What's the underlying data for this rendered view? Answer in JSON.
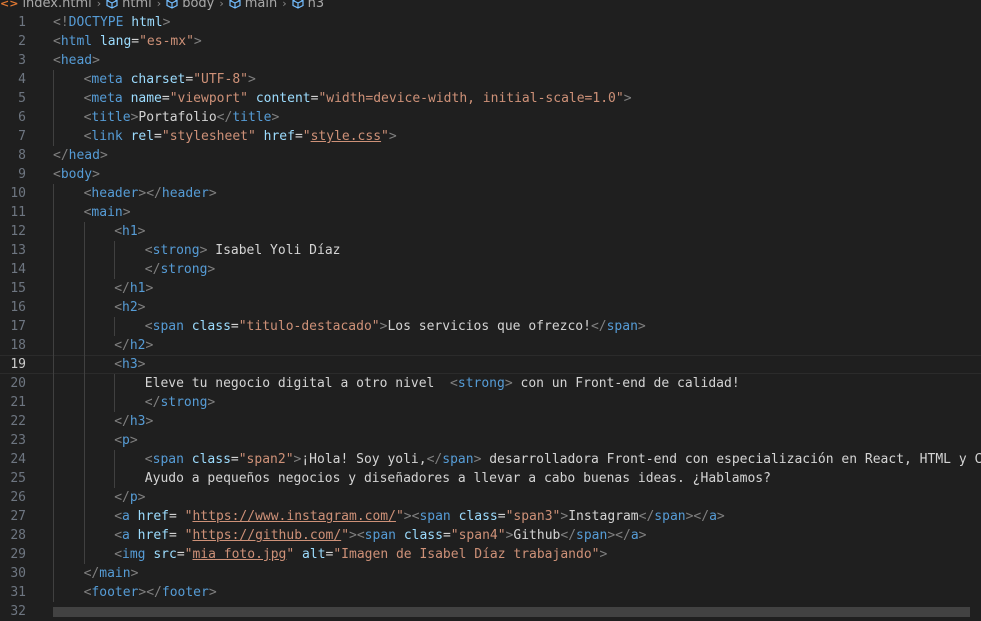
{
  "breadcrumb": {
    "file": "index.html",
    "items": [
      "html",
      "body",
      "main",
      "h3"
    ]
  },
  "active_line": 19,
  "colors": {
    "background": "#1f1f1f",
    "punctuation": "#808080",
    "tag": "#569cd6",
    "attribute": "#9cdcfe",
    "string": "#ce9178",
    "text": "#d4d4d4",
    "line_number": "#6e7681"
  },
  "lines": [
    {
      "n": "1",
      "indent": 0,
      "tokens": [
        [
          "t",
          "<!"
        ],
        [
          "tn",
          "DOCTYPE"
        ],
        [
          "tx",
          " "
        ],
        [
          "an",
          "html"
        ],
        [
          "t",
          ">"
        ]
      ]
    },
    {
      "n": "2",
      "indent": 0,
      "tokens": [
        [
          "t",
          "<"
        ],
        [
          "tn",
          "html"
        ],
        [
          "tx",
          " "
        ],
        [
          "an",
          "lang"
        ],
        [
          "tx",
          "="
        ],
        [
          "av",
          "\"es-mx\""
        ],
        [
          "t",
          ">"
        ]
      ]
    },
    {
      "n": "3",
      "indent": 0,
      "tokens": [
        [
          "t",
          "<"
        ],
        [
          "tn",
          "head"
        ],
        [
          "t",
          ">"
        ]
      ]
    },
    {
      "n": "4",
      "indent": 1,
      "tokens": [
        [
          "t",
          "<"
        ],
        [
          "tn",
          "meta"
        ],
        [
          "tx",
          " "
        ],
        [
          "an",
          "charset"
        ],
        [
          "tx",
          "="
        ],
        [
          "av",
          "\"UTF-8\""
        ],
        [
          "t",
          ">"
        ]
      ]
    },
    {
      "n": "5",
      "indent": 1,
      "tokens": [
        [
          "t",
          "<"
        ],
        [
          "tn",
          "meta"
        ],
        [
          "tx",
          " "
        ],
        [
          "an",
          "name"
        ],
        [
          "tx",
          "="
        ],
        [
          "av",
          "\"viewport\""
        ],
        [
          "tx",
          " "
        ],
        [
          "an",
          "content"
        ],
        [
          "tx",
          "="
        ],
        [
          "av",
          "\"width=device-width, initial-scale=1.0\""
        ],
        [
          "t",
          ">"
        ]
      ]
    },
    {
      "n": "6",
      "indent": 1,
      "tokens": [
        [
          "t",
          "<"
        ],
        [
          "tn",
          "title"
        ],
        [
          "t",
          ">"
        ],
        [
          "tx",
          "Portafolio"
        ],
        [
          "t",
          "</"
        ],
        [
          "tn",
          "title"
        ],
        [
          "t",
          ">"
        ]
      ]
    },
    {
      "n": "7",
      "indent": 1,
      "tokens": [
        [
          "t",
          "<"
        ],
        [
          "tn",
          "link"
        ],
        [
          "tx",
          " "
        ],
        [
          "an",
          "rel"
        ],
        [
          "tx",
          "="
        ],
        [
          "av",
          "\"stylesheet\""
        ],
        [
          "tx",
          " "
        ],
        [
          "an",
          "href"
        ],
        [
          "tx",
          "="
        ],
        [
          "av",
          "\""
        ],
        [
          "avu",
          "style.css"
        ],
        [
          "av",
          "\""
        ],
        [
          "t",
          ">"
        ]
      ]
    },
    {
      "n": "8",
      "indent": 0,
      "tokens": [
        [
          "t",
          "</"
        ],
        [
          "tn",
          "head"
        ],
        [
          "t",
          ">"
        ]
      ]
    },
    {
      "n": "9",
      "indent": 0,
      "tokens": [
        [
          "t",
          "<"
        ],
        [
          "tn",
          "body"
        ],
        [
          "t",
          ">"
        ]
      ]
    },
    {
      "n": "10",
      "indent": 1,
      "tokens": [
        [
          "t",
          "<"
        ],
        [
          "tn",
          "header"
        ],
        [
          "t",
          "></"
        ],
        [
          "tn",
          "header"
        ],
        [
          "t",
          ">"
        ]
      ]
    },
    {
      "n": "11",
      "indent": 1,
      "tokens": [
        [
          "t",
          "<"
        ],
        [
          "tn",
          "main"
        ],
        [
          "t",
          ">"
        ]
      ]
    },
    {
      "n": "12",
      "indent": 2,
      "tokens": [
        [
          "t",
          "<"
        ],
        [
          "tn",
          "h1"
        ],
        [
          "t",
          ">"
        ]
      ]
    },
    {
      "n": "13",
      "indent": 3,
      "tokens": [
        [
          "t",
          "<"
        ],
        [
          "tn",
          "strong"
        ],
        [
          "t",
          ">"
        ],
        [
          "tx",
          " Isabel Yoli Díaz"
        ]
      ]
    },
    {
      "n": "14",
      "indent": 3,
      "tokens": [
        [
          "t",
          "</"
        ],
        [
          "tn",
          "strong"
        ],
        [
          "t",
          ">"
        ]
      ]
    },
    {
      "n": "15",
      "indent": 2,
      "tokens": [
        [
          "t",
          "</"
        ],
        [
          "tn",
          "h1"
        ],
        [
          "t",
          ">"
        ]
      ]
    },
    {
      "n": "16",
      "indent": 2,
      "tokens": [
        [
          "t",
          "<"
        ],
        [
          "tn",
          "h2"
        ],
        [
          "t",
          ">"
        ]
      ]
    },
    {
      "n": "17",
      "indent": 3,
      "tokens": [
        [
          "t",
          "<"
        ],
        [
          "tn",
          "span"
        ],
        [
          "tx",
          " "
        ],
        [
          "an",
          "class"
        ],
        [
          "tx",
          "="
        ],
        [
          "av",
          "\"titulo-destacado\""
        ],
        [
          "t",
          ">"
        ],
        [
          "tx",
          "Los servicios que ofrezco!"
        ],
        [
          "t",
          "</"
        ],
        [
          "tn",
          "span"
        ],
        [
          "t",
          ">"
        ]
      ]
    },
    {
      "n": "18",
      "indent": 2,
      "tokens": [
        [
          "t",
          "</"
        ],
        [
          "tn",
          "h2"
        ],
        [
          "t",
          ">"
        ]
      ]
    },
    {
      "n": "19",
      "indent": 2,
      "tokens": [
        [
          "t",
          "<"
        ],
        [
          "tn",
          "h3"
        ],
        [
          "t",
          ">"
        ]
      ]
    },
    {
      "n": "20",
      "indent": 3,
      "tokens": [
        [
          "tx",
          "Eleve tu negocio digital a otro nivel  "
        ],
        [
          "t",
          "<"
        ],
        [
          "tn",
          "strong"
        ],
        [
          "t",
          ">"
        ],
        [
          "tx",
          " con un Front-end de calidad!"
        ]
      ]
    },
    {
      "n": "21",
      "indent": 3,
      "tokens": [
        [
          "t",
          "</"
        ],
        [
          "tn",
          "strong"
        ],
        [
          "t",
          ">"
        ]
      ]
    },
    {
      "n": "22",
      "indent": 2,
      "tokens": [
        [
          "t",
          "</"
        ],
        [
          "tn",
          "h3"
        ],
        [
          "t",
          ">"
        ]
      ]
    },
    {
      "n": "23",
      "indent": 2,
      "tokens": [
        [
          "t",
          "<"
        ],
        [
          "tn",
          "p"
        ],
        [
          "t",
          ">"
        ]
      ]
    },
    {
      "n": "24",
      "indent": 3,
      "tokens": [
        [
          "t",
          "<"
        ],
        [
          "tn",
          "span"
        ],
        [
          "tx",
          " "
        ],
        [
          "an",
          "class"
        ],
        [
          "tx",
          "="
        ],
        [
          "av",
          "\"span2\""
        ],
        [
          "t",
          ">"
        ],
        [
          "tx",
          "¡Hola! Soy yoli,"
        ],
        [
          "t",
          "</"
        ],
        [
          "tn",
          "span"
        ],
        [
          "t",
          ">"
        ],
        [
          "tx",
          " desarrolladora Front-end con especialización en React, HTML y CSS"
        ]
      ]
    },
    {
      "n": "25",
      "indent": 3,
      "tokens": [
        [
          "tx",
          "Ayudo a pequeños negocios y diseñadores a llevar a cabo buenas ideas. ¿Hablamos?"
        ]
      ]
    },
    {
      "n": "26",
      "indent": 2,
      "tokens": [
        [
          "t",
          "</"
        ],
        [
          "tn",
          "p"
        ],
        [
          "t",
          ">"
        ]
      ]
    },
    {
      "n": "27",
      "indent": 2,
      "tokens": [
        [
          "t",
          "<"
        ],
        [
          "tn",
          "a"
        ],
        [
          "tx",
          " "
        ],
        [
          "an",
          "href"
        ],
        [
          "tx",
          "= "
        ],
        [
          "av",
          "\""
        ],
        [
          "avu",
          "https://www.instagram.com/"
        ],
        [
          "av",
          "\""
        ],
        [
          "t",
          "><"
        ],
        [
          "tn",
          "span"
        ],
        [
          "tx",
          " "
        ],
        [
          "an",
          "class"
        ],
        [
          "tx",
          "="
        ],
        [
          "av",
          "\"span3\""
        ],
        [
          "t",
          ">"
        ],
        [
          "tx",
          "Instagram"
        ],
        [
          "t",
          "</"
        ],
        [
          "tn",
          "span"
        ],
        [
          "t",
          "></"
        ],
        [
          "tn",
          "a"
        ],
        [
          "t",
          ">"
        ]
      ]
    },
    {
      "n": "28",
      "indent": 2,
      "tokens": [
        [
          "t",
          "<"
        ],
        [
          "tn",
          "a"
        ],
        [
          "tx",
          " "
        ],
        [
          "an",
          "href"
        ],
        [
          "tx",
          "= "
        ],
        [
          "av",
          "\""
        ],
        [
          "avu",
          "https://github.com/"
        ],
        [
          "av",
          "\""
        ],
        [
          "t",
          "><"
        ],
        [
          "tn",
          "span"
        ],
        [
          "tx",
          " "
        ],
        [
          "an",
          "class"
        ],
        [
          "tx",
          "="
        ],
        [
          "av",
          "\"span4\""
        ],
        [
          "t",
          ">"
        ],
        [
          "tx",
          "Github"
        ],
        [
          "t",
          "</"
        ],
        [
          "tn",
          "span"
        ],
        [
          "t",
          "></"
        ],
        [
          "tn",
          "a"
        ],
        [
          "t",
          ">"
        ]
      ]
    },
    {
      "n": "29",
      "indent": 2,
      "tokens": [
        [
          "t",
          "<"
        ],
        [
          "tn",
          "img"
        ],
        [
          "tx",
          " "
        ],
        [
          "an",
          "src"
        ],
        [
          "tx",
          "="
        ],
        [
          "av",
          "\""
        ],
        [
          "avu",
          "mia foto.jpg"
        ],
        [
          "av",
          "\""
        ],
        [
          "tx",
          " "
        ],
        [
          "an",
          "alt"
        ],
        [
          "tx",
          "="
        ],
        [
          "av",
          "\"Imagen de Isabel Díaz trabajando\""
        ],
        [
          "t",
          ">"
        ]
      ]
    },
    {
      "n": "30",
      "indent": 1,
      "tokens": [
        [
          "t",
          "</"
        ],
        [
          "tn",
          "main"
        ],
        [
          "t",
          ">"
        ]
      ]
    },
    {
      "n": "31",
      "indent": 1,
      "tokens": [
        [
          "t",
          "<"
        ],
        [
          "tn",
          "footer"
        ],
        [
          "t",
          "></"
        ],
        [
          "tn",
          "footer"
        ],
        [
          "t",
          ">"
        ]
      ]
    },
    {
      "n": "32",
      "indent": 0,
      "tokens": []
    }
  ]
}
